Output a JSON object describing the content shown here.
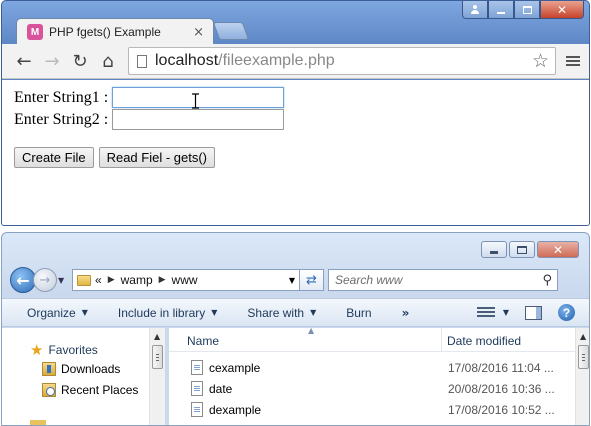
{
  "browser": {
    "tab_title": "PHP fgets() Example",
    "tab_favicon": "M",
    "tab_close": "×",
    "url_host": "localhost",
    "url_path": "/fileexample.php",
    "icons": {
      "back": "back-arrow-icon",
      "forward": "forward-arrow-icon",
      "reload": "reload-icon",
      "home": "home-icon",
      "star": "bookmark-star-icon",
      "menu": "menu-icon"
    },
    "window_close": "✕"
  },
  "page": {
    "label1": "Enter String1 :",
    "label2": "Enter String2 :",
    "input1_value": "",
    "input2_value": "",
    "create_button": "Create File",
    "read_button": "Read Fiel - gets()"
  },
  "explorer": {
    "breadcrumb_prefix": "«",
    "breadcrumb": [
      "wamp",
      "www"
    ],
    "search_placeholder": "Search www",
    "commands": {
      "organize": "Organize",
      "include": "Include in library",
      "share": "Share with",
      "burn": "Burn",
      "more": "»"
    },
    "nav": {
      "favorites": "Favorites",
      "downloads": "Downloads",
      "recent": "Recent Places"
    },
    "columns": {
      "name": "Name",
      "date": "Date modified"
    },
    "files": [
      {
        "name": "cexample",
        "date": "17/08/2016 11:04 ..."
      },
      {
        "name": "date",
        "date": "20/08/2016 10:36 ..."
      },
      {
        "name": "dexample",
        "date": "17/08/2016 10:52 ..."
      }
    ],
    "window_close": "✕"
  }
}
